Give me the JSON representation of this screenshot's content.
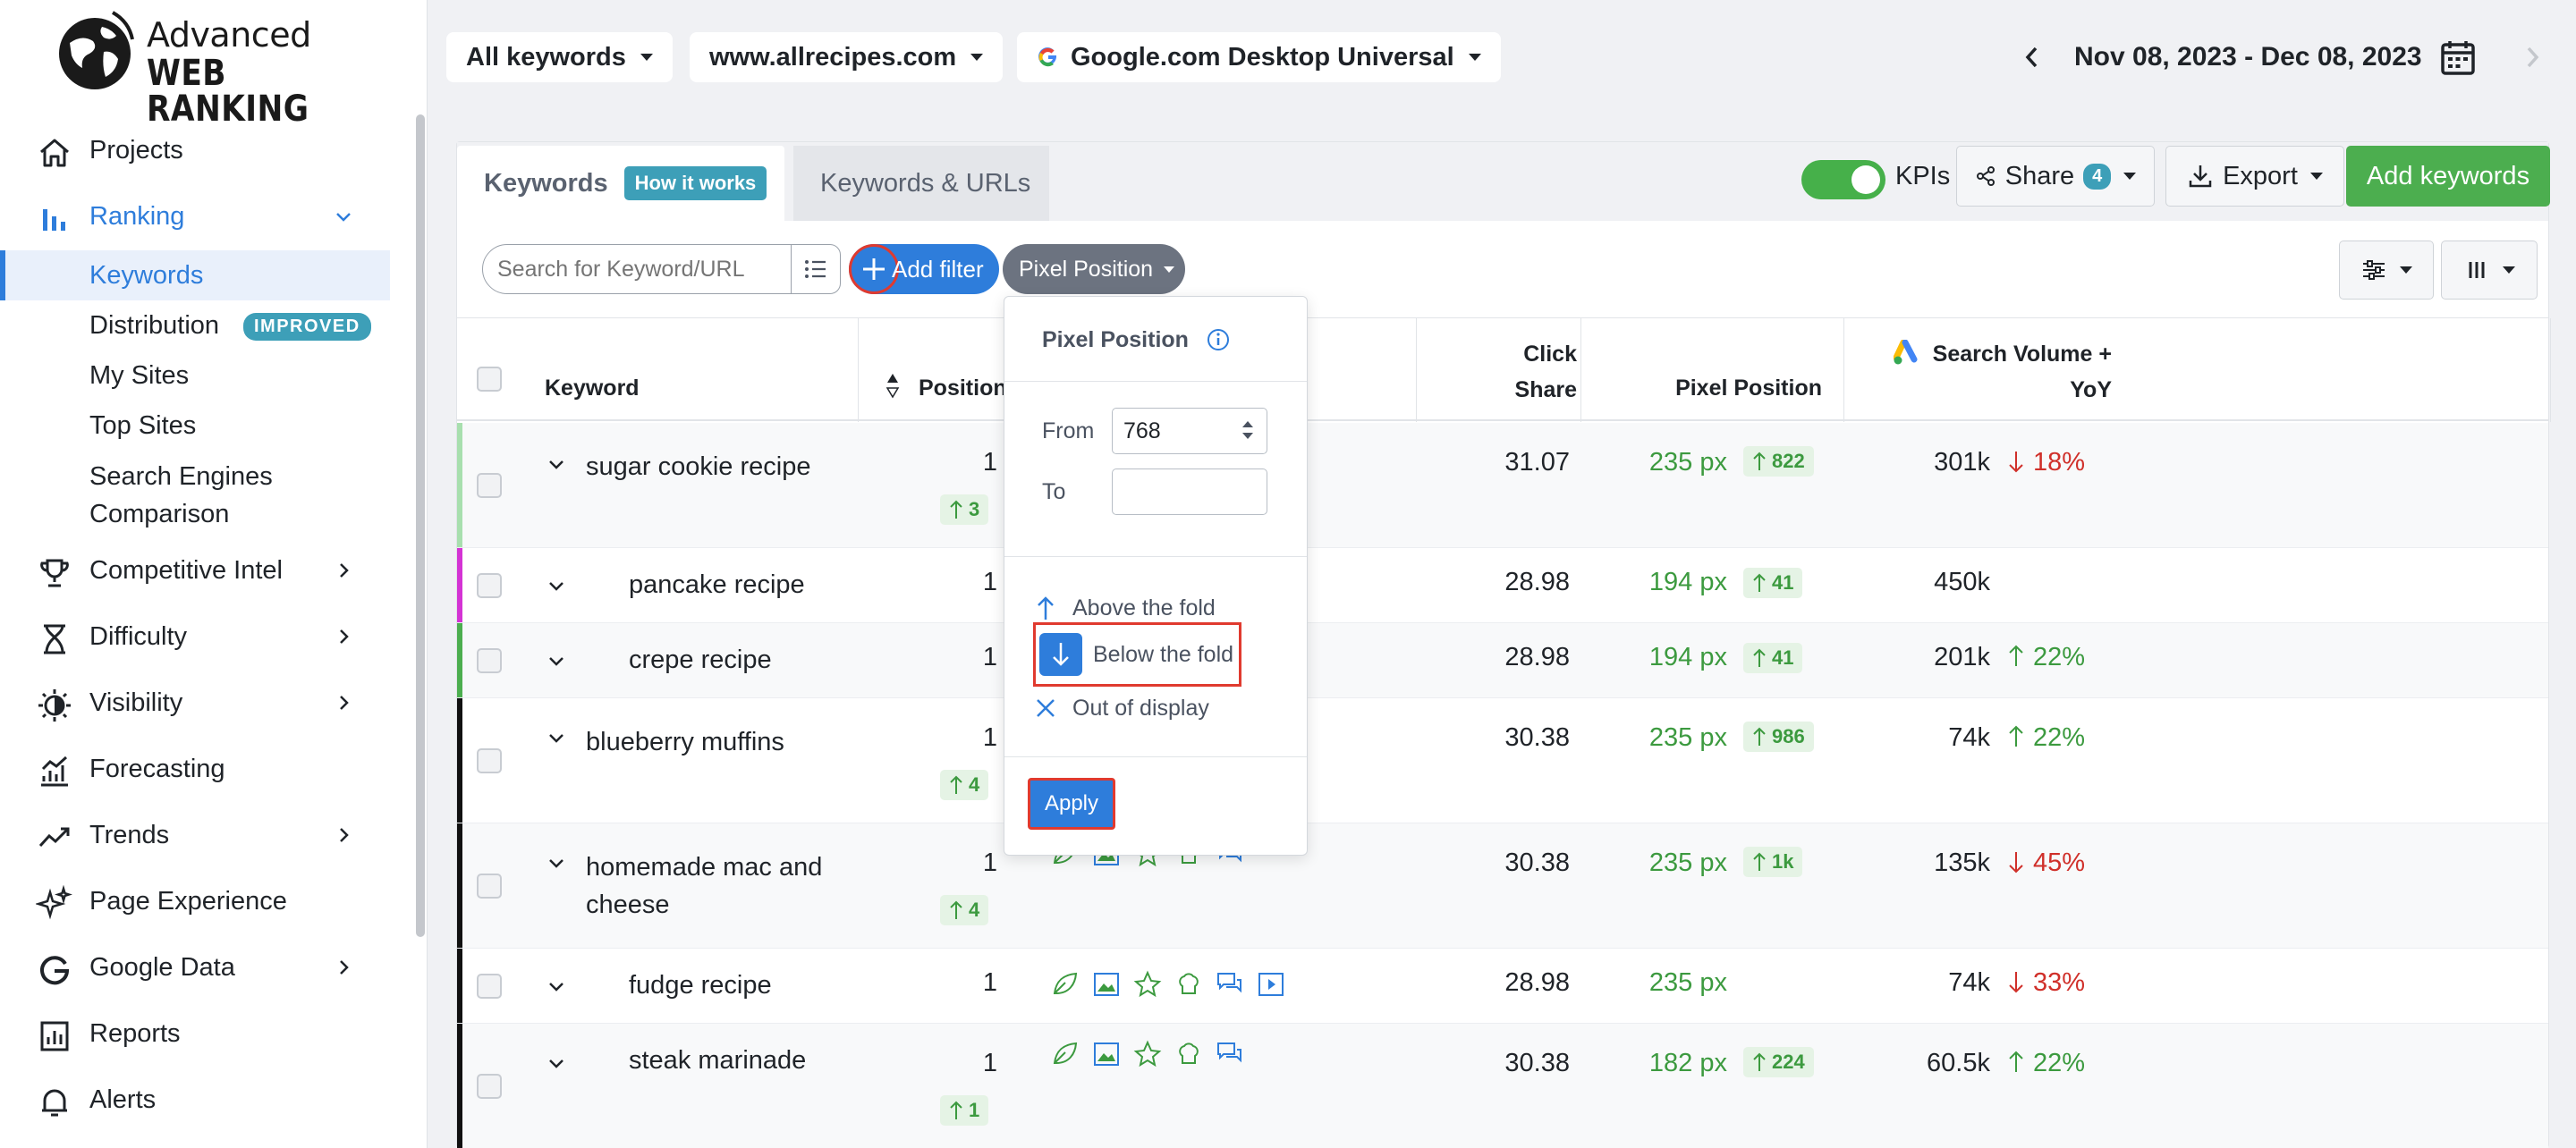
{
  "logo": {
    "line1": "Advanced",
    "line2": "WEB RANKING"
  },
  "nav": {
    "projects": "Projects",
    "ranking": "Ranking",
    "ranking_sub": {
      "keywords": "Keywords",
      "distribution": "Distribution",
      "distribution_badge": "IMPROVED",
      "my_sites": "My Sites",
      "top_sites": "Top Sites",
      "search_engines_1": "Search Engines",
      "search_engines_2": "Comparison"
    },
    "competitive_intel": "Competitive Intel",
    "difficulty": "Difficulty",
    "visibility": "Visibility",
    "forecasting": "Forecasting",
    "trends": "Trends",
    "page_experience": "Page Experience",
    "google_data": "Google Data",
    "reports": "Reports",
    "alerts": "Alerts"
  },
  "topbar": {
    "keyword_group": "All keywords",
    "website": "www.allrecipes.com",
    "search_engine": "Google.com Desktop Universal",
    "date_range": "Nov 08, 2023 - Dec 08, 2023"
  },
  "tabs": {
    "keywords": "Keywords",
    "how_it_works": "How it works",
    "keywords_urls": "Keywords & URLs"
  },
  "actions": {
    "kpis": "KPIs",
    "share": "Share",
    "share_count": "4",
    "export": "Export",
    "add_keywords": "Add keywords"
  },
  "filters": {
    "search_placeholder": "Search for Keyword/URL",
    "add_filter": "Add filter",
    "active_filter": "Pixel Position"
  },
  "columns": {
    "keyword": "Keyword",
    "position": "Position",
    "click_share_1": "Click",
    "click_share_2": "Share",
    "pixel_position": "Pixel Position",
    "search_volume_1": "Search Volume +",
    "search_volume_2": "YoY"
  },
  "rows": [
    {
      "keyword": "sugar cookie recipe",
      "keyword2": "",
      "position": "1",
      "pos_change": "3",
      "click_share": "31.07",
      "pixel": "235 px",
      "pixel_change": "822",
      "volume": "301k",
      "yoy": "18%",
      "yoy_dir": "down"
    },
    {
      "keyword": "pancake recipe",
      "keyword2": "",
      "position": "1",
      "pos_change": "",
      "click_share": "28.98",
      "pixel": "194 px",
      "pixel_change": "41",
      "volume": "450k",
      "yoy": "",
      "yoy_dir": ""
    },
    {
      "keyword": "crepe recipe",
      "keyword2": "",
      "position": "1",
      "pos_change": "",
      "click_share": "28.98",
      "pixel": "194 px",
      "pixel_change": "41",
      "volume": "201k",
      "yoy": "22%",
      "yoy_dir": "up"
    },
    {
      "keyword": "blueberry muffins",
      "keyword2": "",
      "position": "1",
      "pos_change": "4",
      "click_share": "30.38",
      "pixel": "235 px",
      "pixel_change": "986",
      "volume": "74k",
      "yoy": "22%",
      "yoy_dir": "up"
    },
    {
      "keyword": "homemade mac and",
      "keyword2": "cheese",
      "position": "1",
      "pos_change": "4",
      "click_share": "30.38",
      "pixel": "235 px",
      "pixel_change": "1k",
      "volume": "135k",
      "yoy": "45%",
      "yoy_dir": "down"
    },
    {
      "keyword": "fudge recipe",
      "keyword2": "",
      "position": "1",
      "pos_change": "",
      "click_share": "28.98",
      "pixel": "235 px",
      "pixel_change": "",
      "volume": "74k",
      "yoy": "33%",
      "yoy_dir": "down"
    },
    {
      "keyword": "steak marinade",
      "keyword2": "",
      "position": "1",
      "pos_change": "1",
      "click_share": "30.38",
      "pixel": "182 px",
      "pixel_change": "224",
      "volume": "60.5k",
      "yoy": "22%",
      "yoy_dir": "up"
    }
  ],
  "popup": {
    "title": "Pixel Position",
    "from_label": "From",
    "from_value": "768",
    "to_label": "To",
    "to_value": "",
    "options": [
      "Above the fold",
      "Below the fold",
      "Out of display"
    ],
    "selected_option": "Below the fold",
    "apply": "Apply"
  },
  "colors": {
    "accent": "#2e7ddb",
    "green": "#4cae4f",
    "badge": "#3d9fb8",
    "highlight": "#e03a2f",
    "up": "#3c9a3f",
    "down": "#d0302a"
  }
}
